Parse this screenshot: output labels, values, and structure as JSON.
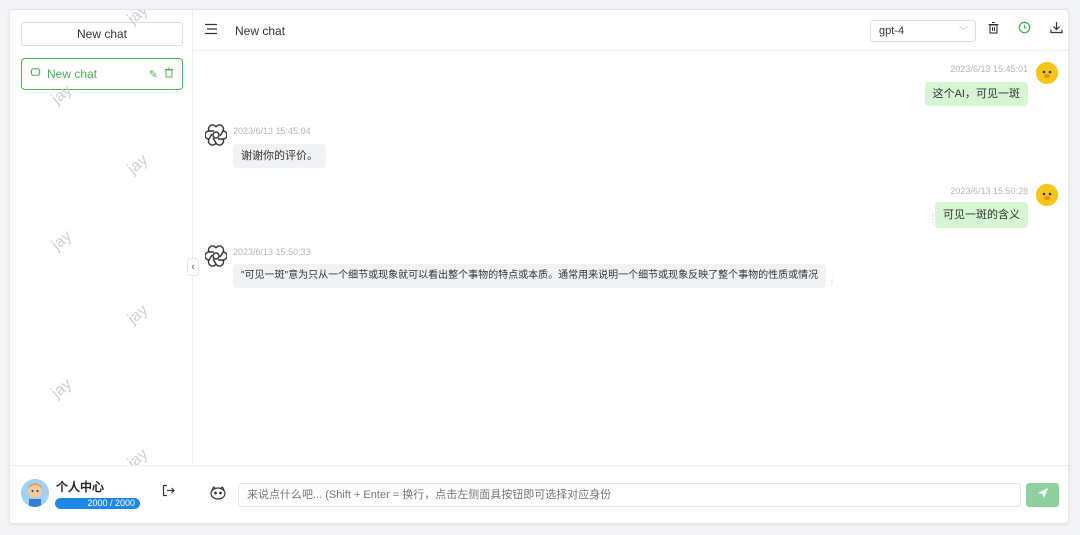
{
  "sidebar": {
    "new_chat_label": "New chat",
    "chats": [
      {
        "label": "New chat",
        "active": true
      }
    ],
    "watermark_text": "jay",
    "user": {
      "name": "个人中心",
      "quota": "2000 / 2000"
    }
  },
  "header": {
    "title": "New chat",
    "model": "gpt-4"
  },
  "messages": [
    {
      "role": "user",
      "time": "2023/6/13 15:45:01",
      "text": "这个AI，可见一斑"
    },
    {
      "role": "assistant",
      "time": "2023/6/13 15:45:04",
      "text": "谢谢你的评价。"
    },
    {
      "role": "user",
      "time": "2023/6/13 15:50:28",
      "text": "可见一斑的含义"
    },
    {
      "role": "assistant",
      "time": "2023/6/13 15:50:33",
      "text": "\"可见一斑\"意为只从一个细节或现象就可以看出整个事物的特点或本质。通常用来说明一个细节或现象反映了整个事物的性质或情况"
    }
  ],
  "input": {
    "placeholder": "来说点什么吧... (Shift + Enter = 换行，点击左侧面具按钮即可选择对应身份"
  },
  "colors": {
    "accent": "#4caf50",
    "user_bubble": "#d6f5d2",
    "bot_bubble": "#f1f2f4",
    "quota_bar": "#1e88e5",
    "send_button": "#8fd19e"
  },
  "icons": {
    "chat_item": "message-icon",
    "edit": "pencil-icon",
    "delete": "trash-icon",
    "menu": "hamburger-icon",
    "clear": "trash-icon",
    "whatsapp": "chat-bubble-icon",
    "download": "download-icon",
    "logout": "logout-icon",
    "mask": "mask-icon",
    "send": "send-icon",
    "bot_avatar": "openai-logo-icon"
  }
}
